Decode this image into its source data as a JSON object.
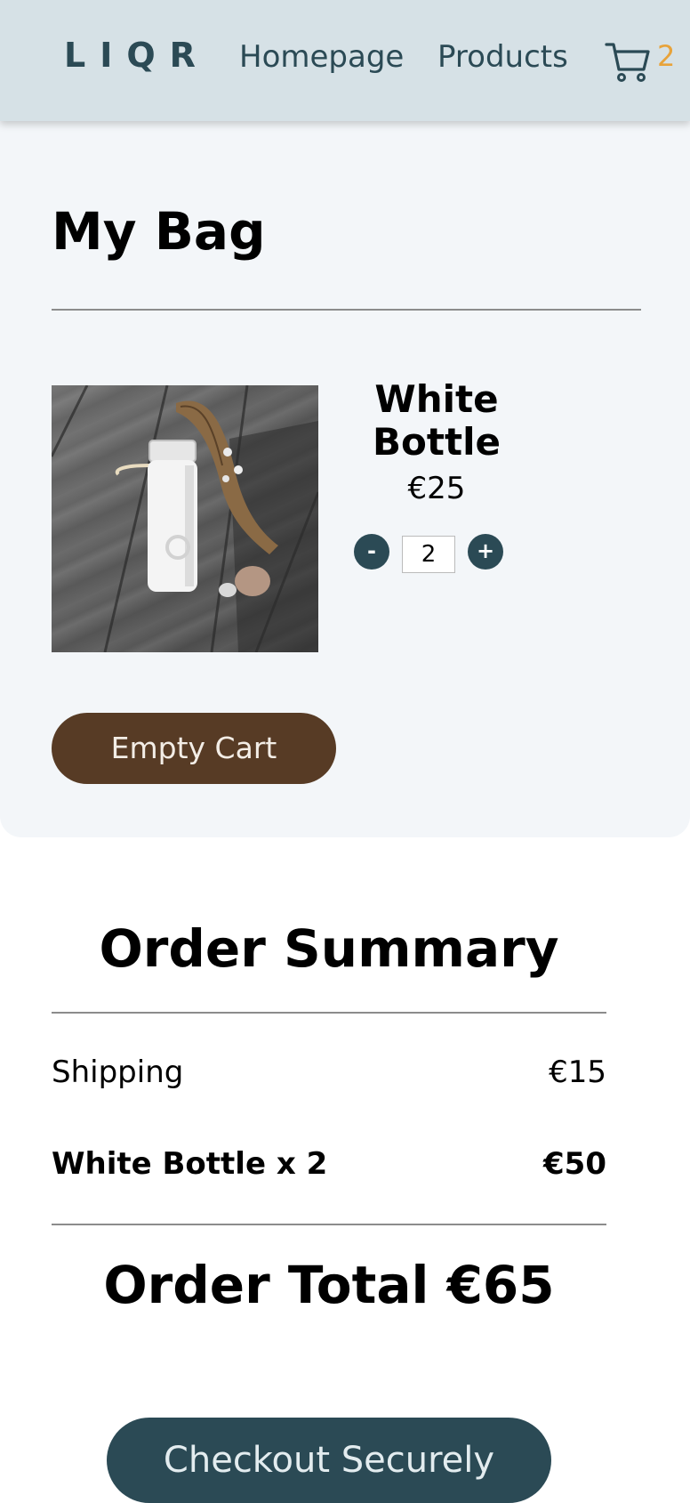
{
  "header": {
    "logo": "LIQR",
    "nav": [
      "Homepage",
      "Products"
    ],
    "cart_count": "2",
    "cart_icon": "shopping-cart-icon"
  },
  "bag": {
    "title": "My Bag",
    "item": {
      "name": "White Bottle",
      "price": "€25",
      "quantity": "2",
      "minus_label": "-",
      "plus_label": "+"
    },
    "empty_cart_label": "Empty Cart"
  },
  "summary": {
    "title": "Order Summary",
    "shipping_label": "Shipping",
    "shipping_value": "€15",
    "item_label": "White Bottle x 2",
    "item_value": "€50",
    "total": "Order Total €65",
    "checkout_label": "Checkout Securely"
  },
  "colors": {
    "header_bg": "#d6e1e6",
    "primary": "#2b4a55",
    "accent": "#e8a33a",
    "brown": "#573b25"
  }
}
